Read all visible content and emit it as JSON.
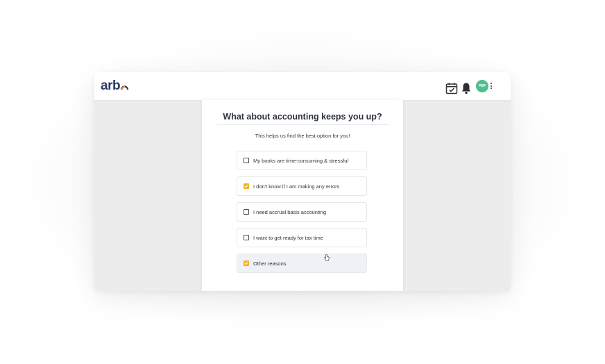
{
  "app": {
    "logo_text": "arb"
  },
  "header": {
    "calendar_icon": "calendar-check-icon",
    "bell_icon": "bell-icon",
    "avatar_initials": "PBP",
    "menu_icon": "kebab-menu-icon"
  },
  "survey": {
    "title": "What about accounting keeps you up?",
    "subtitle": "This helps us find the best option for you!",
    "options": [
      {
        "label": "My books are time-consuming & stressful",
        "checked": false
      },
      {
        "label": "I don't know if I am making any errors",
        "checked": true
      },
      {
        "label": "I need accrual basis accounting",
        "checked": false
      },
      {
        "label": "I want to get ready for tax time",
        "checked": false
      },
      {
        "label": "Other reasons",
        "checked": true
      }
    ]
  },
  "colors": {
    "brand_navy": "#2b3a66",
    "brand_orange": "#f39c32",
    "checkbox_checked": "#f0b429",
    "avatar": "#4cbf8e"
  }
}
